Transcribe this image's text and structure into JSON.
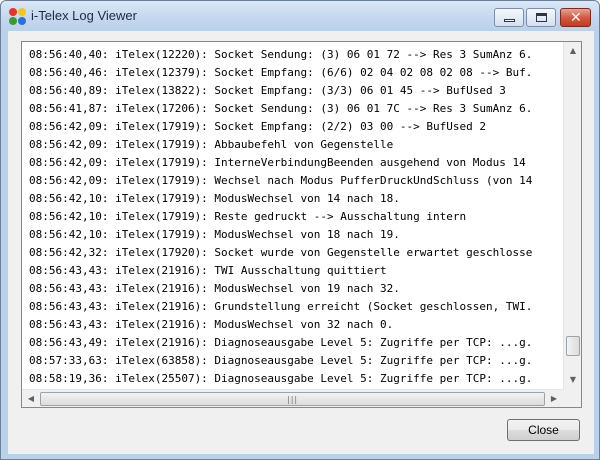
{
  "window": {
    "title": "i-Telex Log Viewer",
    "controls": {
      "minimize": "minimize",
      "maximize": "maximize",
      "close": "✕"
    }
  },
  "log": {
    "lines": [
      "08:56:40,40: iTelex(12220): Socket Sendung: (3) 06 01 72 --> Res 3 SumAnz 6.",
      "08:56:40,46: iTelex(12379): Socket Empfang: (6/6) 02 04 02 08 02 08 --> Buf.",
      "08:56:40,89: iTelex(13822): Socket Empfang: (3/3) 06 01 45 --> BufUsed 3",
      "08:56:41,87: iTelex(17206): Socket Sendung: (3) 06 01 7C --> Res 3 SumAnz 6.",
      "08:56:42,09: iTelex(17919): Socket Empfang: (2/2) 03 00 --> BufUsed 2",
      "08:56:42,09: iTelex(17919): Abbaubefehl von Gegenstelle",
      "08:56:42,09: iTelex(17919): InterneVerbindungBeenden ausgehend von Modus 14",
      "08:56:42,09: iTelex(17919): Wechsel nach Modus PufferDruckUndSchluss (von 14",
      "08:56:42,10: iTelex(17919): ModusWechsel von 14 nach 18.",
      "08:56:42,10: iTelex(17919): Reste gedruckt --> Ausschaltung intern",
      "08:56:42,10: iTelex(17919): ModusWechsel von 18 nach 19.",
      "08:56:42,32: iTelex(17920): Socket wurde von Gegenstelle erwartet geschlosse",
      "08:56:43,43: iTelex(21916): TWI Ausschaltung quittiert",
      "08:56:43,43: iTelex(21916): ModusWechsel von 19 nach 32.",
      "08:56:43,43: iTelex(21916): Grundstellung erreicht (Socket geschlossen, TWI.",
      "08:56:43,43: iTelex(21916): ModusWechsel von 32 nach 0.",
      "08:56:43,49: iTelex(21916): Diagnoseausgabe Level 5: Zugriffe per TCP: ...g.",
      "08:57:33,63: iTelex(63858): Diagnoseausgabe Level 5: Zugriffe per TCP: ...g.",
      "08:58:19,36: iTelex(25507): Diagnoseausgabe Level 5: Zugriffe per TCP: ...g."
    ],
    "vertical_scroll_position": 0.95,
    "scroll_arrows": {
      "up": "▲",
      "down": "▼",
      "left": "◀",
      "right": "▶"
    },
    "grip": "|||"
  },
  "buttons": {
    "close_label": "Close"
  },
  "icons": {
    "app": "i-telex-app-icon"
  },
  "colors": {
    "title_bar": "#c4d8ee",
    "close_control": "#c23a1f",
    "log_background": "#ffffff"
  }
}
